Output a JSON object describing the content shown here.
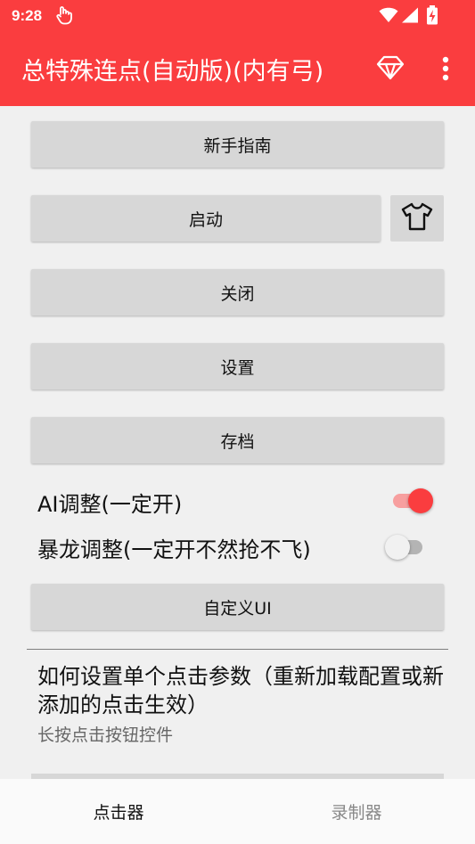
{
  "status_bar": {
    "time": "9:28"
  },
  "app_bar": {
    "title": "总特殊连点(自动版)(内有弓)",
    "vip_icon": "diamond-icon",
    "menu_icon": "more-vert-icon"
  },
  "buttons": {
    "guide": "新手指南",
    "start": "启动",
    "close": "关闭",
    "settings": "设置",
    "save": "存档",
    "custom_ui": "自定义UI"
  },
  "skin_icon": "tshirt-icon",
  "toggles": [
    {
      "label": "AI调整(一定开)",
      "on": true
    },
    {
      "label": "暴龙调整(一定开不然抢不飞)",
      "on": false
    }
  ],
  "info": {
    "title": "如何设置单个点击参数（重新加载配置或新添加的点击生效）",
    "subtitle": "长按点击按钮控件"
  },
  "bottom_nav": [
    {
      "label": "点击器",
      "active": true
    },
    {
      "label": "录制器",
      "active": false
    }
  ],
  "colors": {
    "accent": "#fa3d3f",
    "button": "#d7d7d7",
    "background": "#f0f0f0"
  }
}
